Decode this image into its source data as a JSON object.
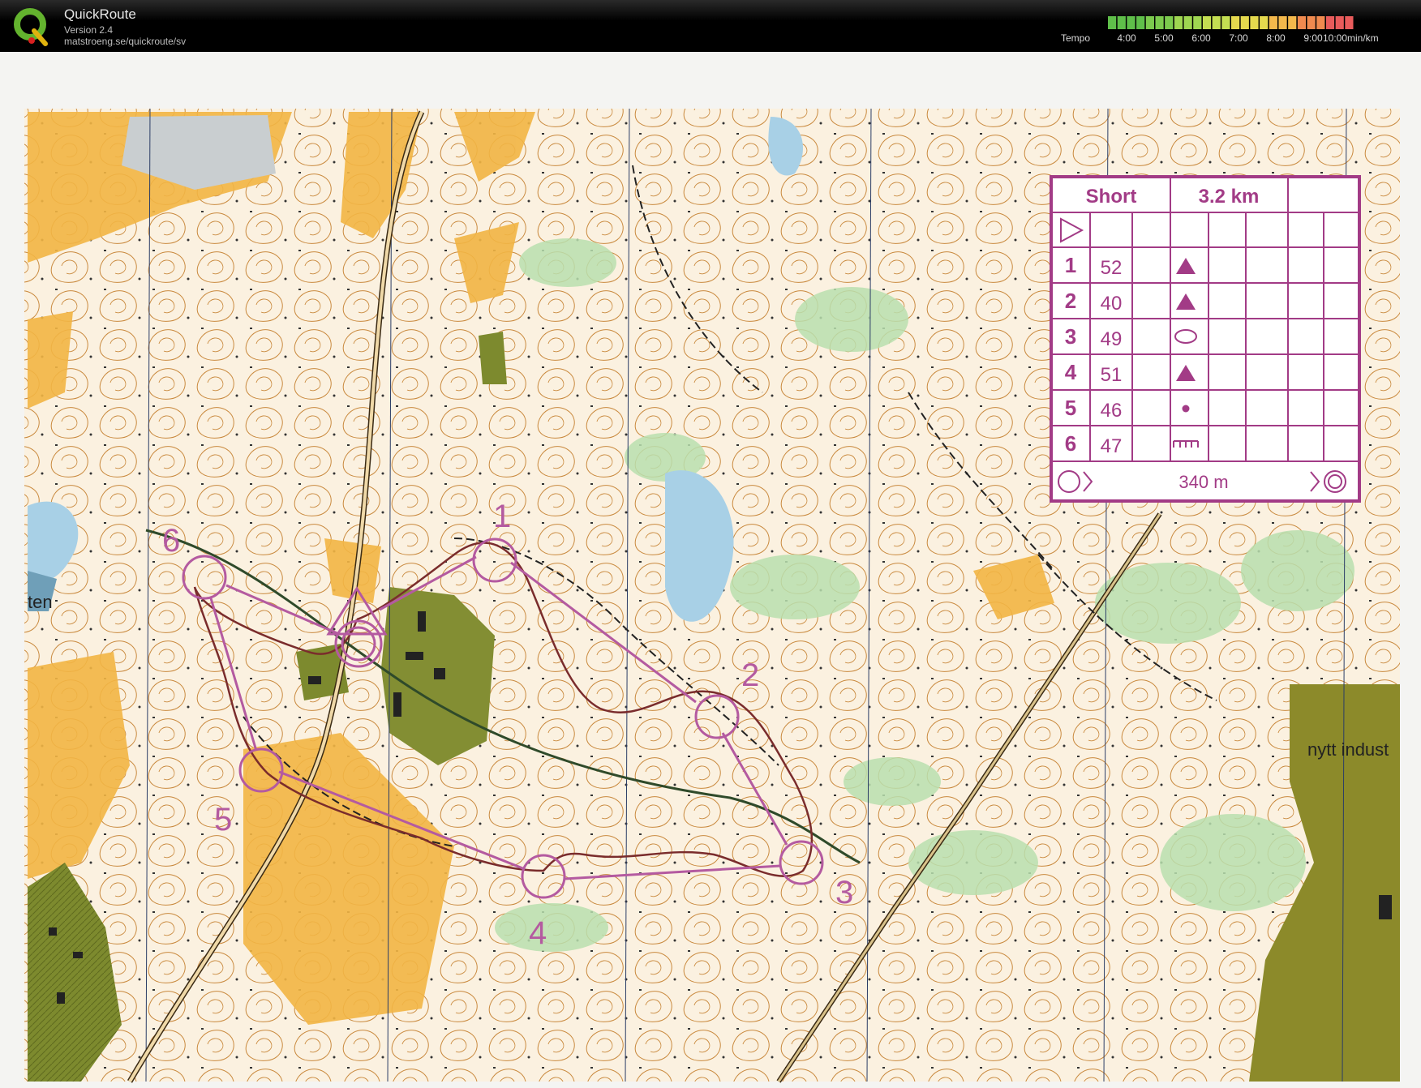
{
  "app": {
    "name": "QuickRoute",
    "version": "Version 2.4",
    "url": "matstroeng.se/quickroute/sv"
  },
  "tempo": {
    "label": "Tempo",
    "ticks": [
      "4:00",
      "5:00",
      "6:00",
      "7:00",
      "8:00",
      "9:00",
      "10:00"
    ],
    "unit": "min/km",
    "colors": [
      "#5fbf4a",
      "#7ccb4e",
      "#9fd651",
      "#c4de52",
      "#e5d94e",
      "#f3b84c",
      "#f08a4f",
      "#e85b5b"
    ]
  },
  "map": {
    "place_labels": [
      "nytt indust",
      "ten"
    ],
    "course_color": "#b45aa0",
    "controls": [
      {
        "label": "1"
      },
      {
        "label": "2"
      },
      {
        "label": "3"
      },
      {
        "label": "4"
      },
      {
        "label": "5"
      },
      {
        "label": "6"
      }
    ]
  },
  "description_sheet": {
    "course_name": "Short",
    "length": "3.2 km",
    "rows": [
      {
        "num": "1",
        "code": "52",
        "symbol": "triangle"
      },
      {
        "num": "2",
        "code": "40",
        "symbol": "triangle"
      },
      {
        "num": "3",
        "code": "49",
        "symbol": "ellipse"
      },
      {
        "num": "4",
        "code": "51",
        "symbol": "triangle"
      },
      {
        "num": "5",
        "code": "46",
        "symbol": "dot"
      },
      {
        "num": "6",
        "code": "47",
        "symbol": "comb"
      }
    ],
    "finish_distance": "340 m"
  }
}
